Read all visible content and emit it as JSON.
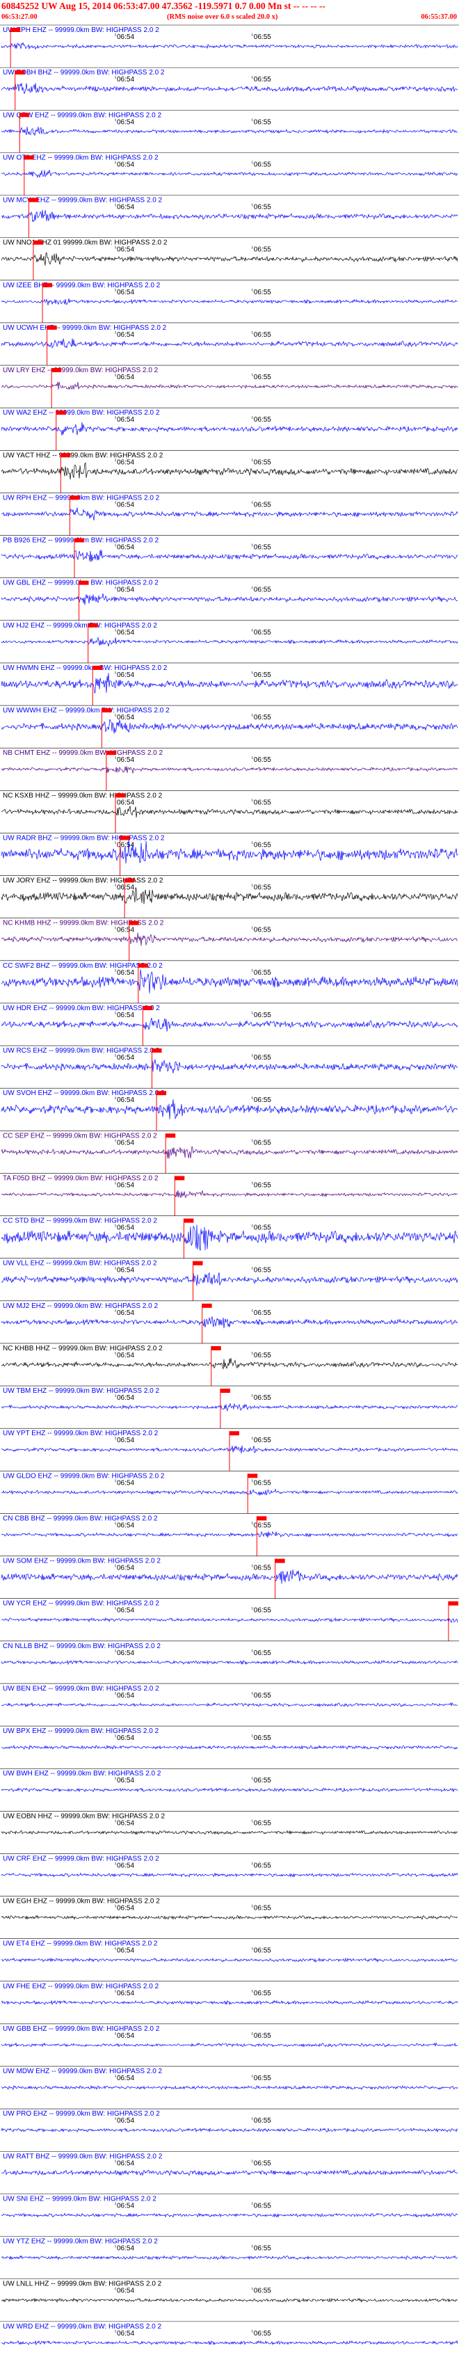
{
  "header": {
    "title": "60845252 UW Aug 15, 2014 06:53:47.00    47.3562 -119.5971  0.7 0.00 Mn st  -- --  -- --",
    "start_time": "06:53:27.00",
    "note": "(RMS noise over 6.0 s scaled 20.0 x)",
    "end_time": "06:55:37.00"
  },
  "chart_data": {
    "type": "seismogram",
    "time_axis": {
      "start": "06:53:27.00",
      "end": "06:55:37.00",
      "tick_labels": [
        "06:54",
        "06:55"
      ]
    },
    "colors": {
      "blue": "#0000ff",
      "black": "#000000",
      "purple": "#4b0082",
      "pick": "#ff0000",
      "title": "#ff0000"
    },
    "traces": [
      {
        "label": "UW EPH EHZ -- 99999.0km BW: HIGHPASS  2.0  2",
        "color": "blue",
        "amp": 2,
        "pick": 0.02
      },
      {
        "label": "UW EOBH BHZ -- 99999.0km BW: HIGHPASS  2.0  2",
        "color": "blue",
        "amp": 3,
        "pick": 0.03
      },
      {
        "label": "UW QPW EHZ -- 99999.0km BW: HIGHPASS  2.0  2",
        "color": "blue",
        "amp": 2,
        "pick": 0.04
      },
      {
        "label": "UW OT3 EHZ -- 99999.0km BW: HIGHPASS  2.0  2",
        "color": "blue",
        "amp": 2,
        "pick": 0.05
      },
      {
        "label": "UW MCW EHZ -- 99999.0km BW: HIGHPASS  2.0  2",
        "color": "blue",
        "amp": 3,
        "pick": 0.06
      },
      {
        "label": "UW NNO1 EHZ 01 99999.0km BW: HIGHPASS  2.0  2",
        "color": "black",
        "amp": 3,
        "pick": 0.07
      },
      {
        "label": "UW IZEE BHZ -- 99999.0km BW: HIGHPASS  2.0  2",
        "color": "blue",
        "amp": 2,
        "pick": 0.09
      },
      {
        "label": "UW UCWH EHZ -- 99999.0km BW: HIGHPASS  2.0  2",
        "color": "blue",
        "amp": 3,
        "pick": 0.1
      },
      {
        "label": "UW LRY EHZ -- 99999.0km BW: HIGHPASS  2.0  2",
        "color": "purple",
        "amp": 2,
        "pick": 0.11
      },
      {
        "label": "UW WA2 EHZ -- 99999.0km BW: HIGHPASS  2.0  2",
        "color": "blue",
        "amp": 3,
        "pick": 0.12
      },
      {
        "label": "UW YACT HHZ -- 99999.0km BW: HIGHPASS  2.0  2",
        "color": "black",
        "amp": 4,
        "pick": 0.13
      },
      {
        "label": "UW RPH EHZ -- 99999.0km BW: HIGHPASS  2.0  2",
        "color": "blue",
        "amp": 3,
        "pick": 0.15
      },
      {
        "label": "PB B926 EHZ -- 99999.0km BW: HIGHPASS  2.0  2",
        "color": "blue",
        "amp": 3,
        "pick": 0.16
      },
      {
        "label": "UW GBL EHZ -- 99999.0km BW: HIGHPASS  2.0  2",
        "color": "blue",
        "amp": 3,
        "pick": 0.17
      },
      {
        "label": "UW HJ2 EHZ -- 99999.0km BW: HIGHPASS  2.0  2",
        "color": "blue",
        "amp": 2,
        "pick": 0.19
      },
      {
        "label": "UW HWMN EHZ -- 99999.0km BW: HIGHPASS  2.0  2",
        "color": "blue",
        "amp": 5,
        "pick": 0.2
      },
      {
        "label": "UW WWWH EHZ -- 99999.0km BW: HIGHPASS  2.0  2",
        "color": "blue",
        "amp": 4,
        "pick": 0.22
      },
      {
        "label": "NB CHMT EHZ -- 99999.0km BW: HIGHPASS  2.0  2",
        "color": "purple",
        "amp": 2,
        "pick": 0.23
      },
      {
        "label": "NC KSXB HHZ -- 99999.0km BW: HIGHPASS  2.0  2",
        "color": "black",
        "amp": 3,
        "pick": 0.25
      },
      {
        "label": "UW RADR BHZ -- 99999.0km BW: HIGHPASS  2.0  2",
        "color": "blue",
        "amp": 7,
        "pick": 0.26
      },
      {
        "label": "UW JORY EHZ -- 99999.0km BW: HIGHPASS  2.0  2",
        "color": "black",
        "amp": 5,
        "pick": 0.27
      },
      {
        "label": "NC KHMB HHZ -- 99999.0km BW: HIGHPASS  2.0  2",
        "color": "purple",
        "amp": 3,
        "pick": 0.28
      },
      {
        "label": "CC SWF2 BHZ -- 99999.0km BW: HIGHPASS  2.0  2",
        "color": "blue",
        "amp": 6,
        "pick": 0.3
      },
      {
        "label": "UW HDR EHZ -- 99999.0km BW: HIGHPASS  2.0  2",
        "color": "blue",
        "amp": 4,
        "pick": 0.31
      },
      {
        "label": "UW RCS EHZ -- 99999.0km BW: HIGHPASS  2.0  2",
        "color": "blue",
        "amp": 4,
        "pick": 0.33
      },
      {
        "label": "UW SVOH EHZ -- 99999.0km BW: HIGHPASS  2.0  2",
        "color": "blue",
        "amp": 5,
        "pick": 0.34
      },
      {
        "label": "CC SEP EHZ -- 99999.0km BW: HIGHPASS  2.0  2",
        "color": "purple",
        "amp": 3,
        "pick": 0.36
      },
      {
        "label": "TA F05D BHZ -- 99999.0km BW: HIGHPASS  2.0  2",
        "color": "purple",
        "amp": 2,
        "pick": 0.38
      },
      {
        "label": "CC STD BHZ -- 99999.0km BW: HIGHPASS  2.0  2",
        "color": "blue",
        "amp": 7,
        "pick": 0.4
      },
      {
        "label": "UW VLL EHZ -- 99999.0km BW: HIGHPASS  2.0  2",
        "color": "blue",
        "amp": 4,
        "pick": 0.42
      },
      {
        "label": "UW MJ2 EHZ -- 99999.0km BW: HIGHPASS  2.0  2",
        "color": "blue",
        "amp": 3,
        "pick": 0.44
      },
      {
        "label": "NC KHBB HHZ -- 99999.0km BW: HIGHPASS  2.0  2",
        "color": "black",
        "amp": 3,
        "pick": 0.46
      },
      {
        "label": "UW TBM EHZ -- 99999.0km BW: HIGHPASS  2.0  2",
        "color": "blue",
        "amp": 2,
        "pick": 0.48
      },
      {
        "label": "UW YPT EHZ -- 99999.0km BW: HIGHPASS  2.0  2",
        "color": "blue",
        "amp": 2,
        "pick": 0.5
      },
      {
        "label": "UW GLDO EHZ -- 99999.0km BW: HIGHPASS  2.0  2",
        "color": "blue",
        "amp": 2,
        "pick": 0.54
      },
      {
        "label": "CN CBB BHZ -- 99999.0km BW: HIGHPASS  2.0  2",
        "color": "blue",
        "amp": 2,
        "pick": 0.56
      },
      {
        "label": "UW SOM EHZ -- 99999.0km BW: HIGHPASS  2.0  2",
        "color": "blue",
        "amp": 4,
        "pick": 0.6
      },
      {
        "label": "UW YCR EHZ -- 99999.0km BW: HIGHPASS  2.0  2",
        "color": "blue",
        "amp": 2,
        "pick": 0.98
      },
      {
        "label": "CN NLLB BHZ -- 99999.0km BW: HIGHPASS  2.0  2",
        "color": "blue",
        "amp": 2
      },
      {
        "label": "UW BEN EHZ -- 99999.0km BW: HIGHPASS  2.0  2",
        "color": "blue",
        "amp": 2
      },
      {
        "label": "UW BPX EHZ -- 99999.0km BW: HIGHPASS  2.0  2",
        "color": "blue",
        "amp": 2
      },
      {
        "label": "UW BWH EHZ -- 99999.0km BW: HIGHPASS  2.0  2",
        "color": "blue",
        "amp": 2
      },
      {
        "label": "UW EOBN HHZ -- 99999.0km BW: HIGHPASS  2.0  2",
        "color": "black",
        "amp": 2
      },
      {
        "label": "UW CRF EHZ -- 99999.0km BW: HIGHPASS  2.0  2",
        "color": "blue",
        "amp": 2
      },
      {
        "label": "UW EGH EHZ -- 99999.0km BW: HIGHPASS  2.0  2",
        "color": "black",
        "amp": 2
      },
      {
        "label": "UW ET4 EHZ -- 99999.0km BW: HIGHPASS  2.0  2",
        "color": "blue",
        "amp": 2
      },
      {
        "label": "UW FHE EHZ -- 99999.0km BW: HIGHPASS  2.0  2",
        "color": "blue",
        "amp": 2
      },
      {
        "label": "UW GBB EHZ -- 99999.0km BW: HIGHPASS  2.0  2",
        "color": "blue",
        "amp": 2
      },
      {
        "label": "UW MDW EHZ -- 99999.0km BW: HIGHPASS  2.0  2",
        "color": "blue",
        "amp": 2
      },
      {
        "label": "UW PRO EHZ -- 99999.0km BW: HIGHPASS  2.0  2",
        "color": "blue",
        "amp": 2
      },
      {
        "label": "UW RATT BHZ -- 99999.0km BW: HIGHPASS  2.0  2",
        "color": "blue",
        "amp": 3
      },
      {
        "label": "UW SNI EHZ -- 99999.0km BW: HIGHPASS  2.0  2",
        "color": "blue",
        "amp": 2
      },
      {
        "label": "UW YTZ EHZ -- 99999.0km BW: HIGHPASS  2.0  2",
        "color": "blue",
        "amp": 2
      },
      {
        "label": "UW LNLL HHZ -- 99999.0km BW: HIGHPASS  2.0  2",
        "color": "black",
        "amp": 2
      },
      {
        "label": "UW WRD EHZ -- 99999.0km BW: HIGHPASS  2.0  2",
        "color": "blue",
        "amp": 2
      }
    ]
  }
}
